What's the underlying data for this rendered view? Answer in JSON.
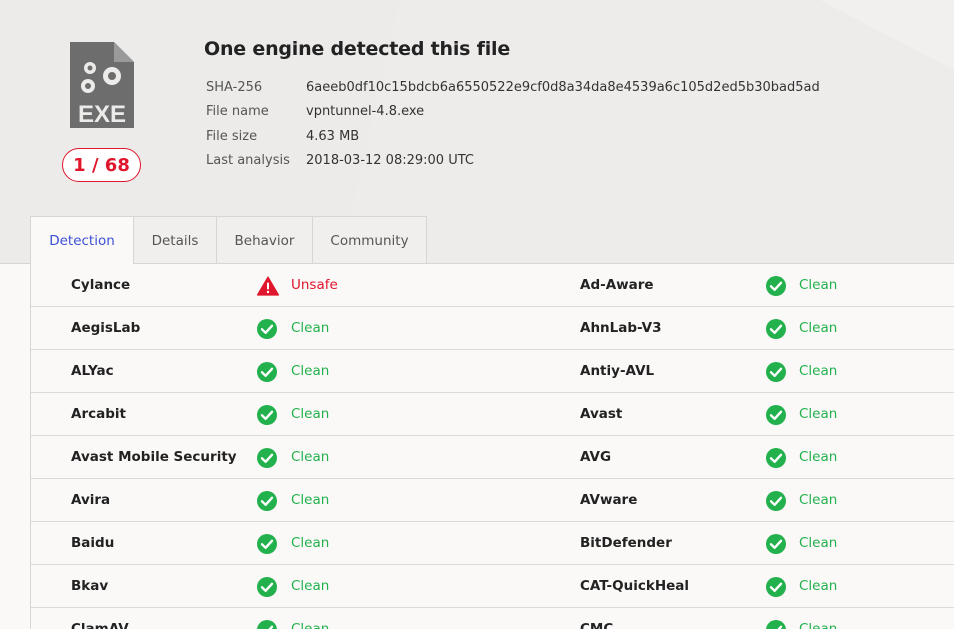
{
  "file": {
    "icon": "exe-file-icon",
    "type_label": "EXE",
    "detection_ratio": "1 / 68",
    "title": "One engine detected this file",
    "meta": [
      {
        "key": "SHA-256",
        "value": "6aeeb0df10c15bdcb6a6550522e9cf0d8a34da8e4539a6c105d2ed5b30bad5ad"
      },
      {
        "key": "File name",
        "value": "vpntunnel-4.8.exe"
      },
      {
        "key": "File size",
        "value": "4.63 MB"
      },
      {
        "key": "Last analysis",
        "value": "2018-03-12 08:29:00 UTC"
      }
    ]
  },
  "tabs": [
    {
      "label": "Detection",
      "active": true
    },
    {
      "label": "Details",
      "active": false
    },
    {
      "label": "Behavior",
      "active": false
    },
    {
      "label": "Community",
      "active": false
    }
  ],
  "colors": {
    "clean": "#22b14c",
    "unsafe": "#e0162c",
    "active_tab": "#3b50d4",
    "icon_gray": "#6d6d6d"
  },
  "detections": [
    [
      {
        "engine": "Cylance",
        "result": "Unsafe",
        "status": "unsafe",
        "icon": "warning-icon"
      },
      {
        "engine": "Ad-Aware",
        "result": "Clean",
        "status": "clean",
        "icon": "check-circle-icon"
      }
    ],
    [
      {
        "engine": "AegisLab",
        "result": "Clean",
        "status": "clean",
        "icon": "check-circle-icon"
      },
      {
        "engine": "AhnLab-V3",
        "result": "Clean",
        "status": "clean",
        "icon": "check-circle-icon"
      }
    ],
    [
      {
        "engine": "ALYac",
        "result": "Clean",
        "status": "clean",
        "icon": "check-circle-icon"
      },
      {
        "engine": "Antiy-AVL",
        "result": "Clean",
        "status": "clean",
        "icon": "check-circle-icon"
      }
    ],
    [
      {
        "engine": "Arcabit",
        "result": "Clean",
        "status": "clean",
        "icon": "check-circle-icon"
      },
      {
        "engine": "Avast",
        "result": "Clean",
        "status": "clean",
        "icon": "check-circle-icon"
      }
    ],
    [
      {
        "engine": "Avast Mobile Security",
        "result": "Clean",
        "status": "clean",
        "icon": "check-circle-icon"
      },
      {
        "engine": "AVG",
        "result": "Clean",
        "status": "clean",
        "icon": "check-circle-icon"
      }
    ],
    [
      {
        "engine": "Avira",
        "result": "Clean",
        "status": "clean",
        "icon": "check-circle-icon"
      },
      {
        "engine": "AVware",
        "result": "Clean",
        "status": "clean",
        "icon": "check-circle-icon"
      }
    ],
    [
      {
        "engine": "Baidu",
        "result": "Clean",
        "status": "clean",
        "icon": "check-circle-icon"
      },
      {
        "engine": "BitDefender",
        "result": "Clean",
        "status": "clean",
        "icon": "check-circle-icon"
      }
    ],
    [
      {
        "engine": "Bkav",
        "result": "Clean",
        "status": "clean",
        "icon": "check-circle-icon"
      },
      {
        "engine": "CAT-QuickHeal",
        "result": "Clean",
        "status": "clean",
        "icon": "check-circle-icon"
      }
    ],
    [
      {
        "engine": "ClamAV",
        "result": "Clean",
        "status": "clean",
        "icon": "check-circle-icon"
      },
      {
        "engine": "CMC",
        "result": "Clean",
        "status": "clean",
        "icon": "check-circle-icon"
      }
    ]
  ]
}
